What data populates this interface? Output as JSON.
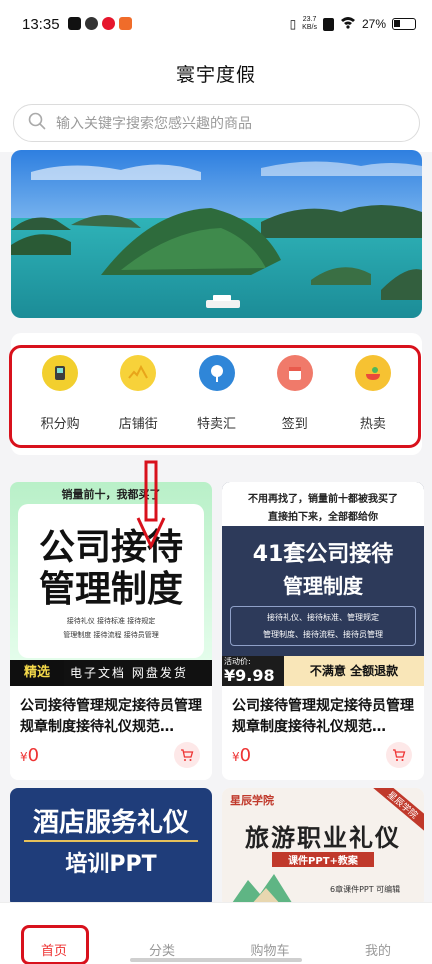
{
  "status_bar": {
    "time": "13:35",
    "net_speed": "23.7",
    "net_unit": "KB/s",
    "battery": "27%"
  },
  "header": {
    "title": "寰宇度假"
  },
  "search": {
    "placeholder": "输入关键字搜索您感兴趣的商品"
  },
  "categories": [
    {
      "label": "积分购",
      "icon": "points-shop-icon"
    },
    {
      "label": "店铺街",
      "icon": "store-street-icon"
    },
    {
      "label": "特卖汇",
      "icon": "special-sale-icon"
    },
    {
      "label": "签到",
      "icon": "check-in-icon"
    },
    {
      "label": "热卖",
      "icon": "hot-sale-icon"
    }
  ],
  "products": [
    {
      "title": "公司接待管理规定接待员管理规章制度接待礼仪规范…",
      "currency": "¥",
      "price": "0",
      "image_text": {
        "top": "销量前十，我都买了",
        "line1": "公司接待",
        "line2": "管理制度",
        "small1": "接待礼仪  接待标准  接待规定",
        "small2": "管理制度  接待流程  接待员管理",
        "badge": "精选",
        "footer": "电子文档 网盘发货"
      }
    },
    {
      "title": "公司接待管理规定接待员管理规章制度接待礼仪规范…",
      "currency": "¥",
      "price": "0",
      "image_text": {
        "top1": "不用再找了，销量前十都被我买了",
        "top2": "直接拍下来，全部都给你",
        "line1": "41套公司接待",
        "line2": "管理制度",
        "small1": "接待礼仪、接待标准、管理规定",
        "small2": "管理制度、接待流程、接待员管理",
        "act": "活动价:",
        "act_price": "¥9.98",
        "refund": "不满意 全额退款"
      }
    },
    {
      "image_text": {
        "line1": "酒店服务礼仪",
        "line2": "培训PPT"
      }
    },
    {
      "image_text": {
        "brand": "星辰学院",
        "line1": "旅游职业礼仪",
        "line2": "课件PPT+教案",
        "ribbon": "星辰学院",
        "foot": "6章课件PPT 可编辑"
      }
    }
  ],
  "tabs": [
    {
      "label": "首页",
      "active": true
    },
    {
      "label": "分类",
      "active": false
    },
    {
      "label": "购物车",
      "active": false
    },
    {
      "label": "我的",
      "active": false
    }
  ],
  "colors": {
    "accent": "#e33333",
    "annotation_red": "#d8111c"
  }
}
